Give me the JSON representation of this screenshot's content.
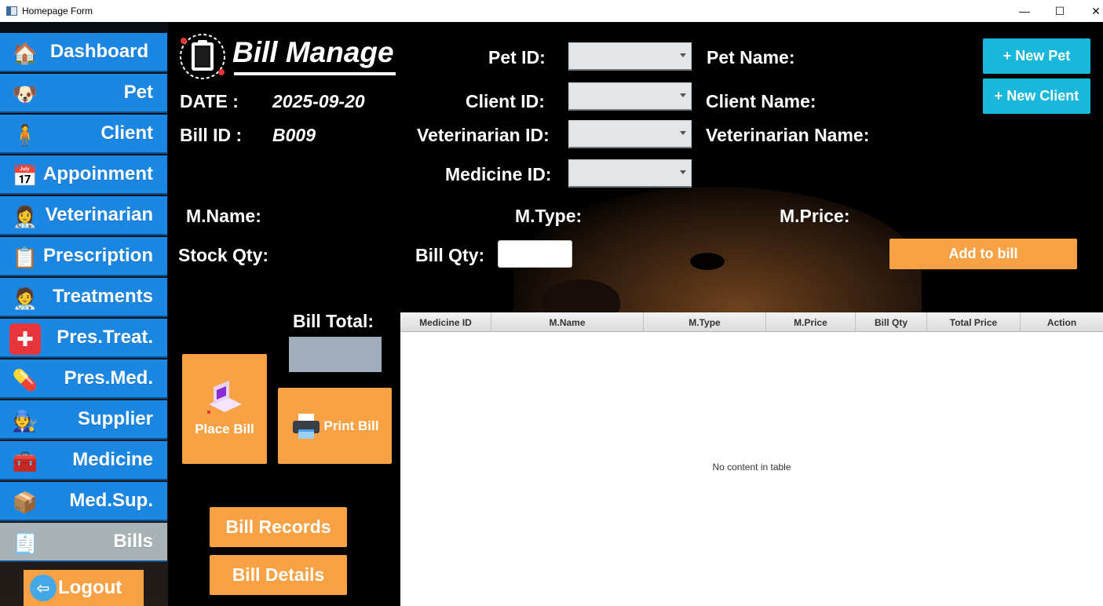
{
  "window": {
    "title": "Homepage Form",
    "controls": {
      "minimize": "—",
      "maximize": "☐",
      "close": "✕"
    }
  },
  "sidebar": {
    "items": [
      {
        "label": "Dashboard",
        "icon": "house-icon",
        "glyph": "🏠"
      },
      {
        "label": "Pet",
        "icon": "pet-icon",
        "glyph": "🐶"
      },
      {
        "label": "Client",
        "icon": "client-walking-dog-icon",
        "glyph": "🧍"
      },
      {
        "label": "Appoinment",
        "icon": "calendar-icon",
        "glyph": "📅"
      },
      {
        "label": "Veterinarian",
        "icon": "veterinarian-icon",
        "glyph": "👩‍⚕️"
      },
      {
        "label": "Prescription",
        "icon": "clipboard-icon",
        "glyph": "📋"
      },
      {
        "label": "Treatments",
        "icon": "treatment-icon",
        "glyph": "🧑‍⚕️"
      },
      {
        "label": "Pres.Treat.",
        "icon": "medical-cross-icon",
        "glyph": "✚"
      },
      {
        "label": "Pres.Med.",
        "icon": "pill-bottle-icon",
        "glyph": "💊"
      },
      {
        "label": "Supplier",
        "icon": "delivery-person-icon",
        "glyph": "🧑‍🔧"
      },
      {
        "label": "Medicine",
        "icon": "medicine-box-icon",
        "glyph": "🧰"
      },
      {
        "label": "Med.Sup.",
        "icon": "cardboard-box-icon",
        "glyph": "📦"
      },
      {
        "label": "Bills",
        "icon": "receipt-printer-icon",
        "glyph": "🧾"
      }
    ],
    "logout": {
      "label": "Logout",
      "glyph": "⇦"
    }
  },
  "header": {
    "title": "Bill Manage",
    "date_label": "DATE :",
    "date_value": "2025-09-20",
    "bill_id_label": "Bill ID :",
    "bill_id_value": "B009"
  },
  "form": {
    "pet_id_label": "Pet ID:",
    "client_id_label": "Client ID:",
    "vet_id_label": "Veterinarian ID:",
    "medicine_id_label": "Medicine ID:",
    "pet_name_label": "Pet Name:",
    "client_name_label": "Client Name:",
    "vet_name_label": "Veterinarian Name:",
    "m_name_label": "M.Name:",
    "m_type_label": "M.Type:",
    "m_price_label": "M.Price:",
    "stock_qty_label": "Stock Qty:",
    "bill_qty_label": "Bill Qty:",
    "bill_total_label": "Bill Total:"
  },
  "buttons": {
    "new_pet": "+ New Pet",
    "new_client": "+ New Client",
    "add_to_bill": "Add to bill",
    "place_bill": "Place Bill",
    "print_bill": "Print Bill",
    "bill_records": "Bill Records",
    "bill_details": "Bill Details"
  },
  "table": {
    "columns": [
      "Medicine ID",
      "M.Name",
      "M.Type",
      "M.Price",
      "Bill Qty",
      "Total Price",
      "Action"
    ],
    "empty_message": "No content in table"
  },
  "colors": {
    "nav_blue": "#1b87e3",
    "nav_active": "#a9b2b6",
    "orange": "#f9a245",
    "cyan": "#18b8dd"
  }
}
